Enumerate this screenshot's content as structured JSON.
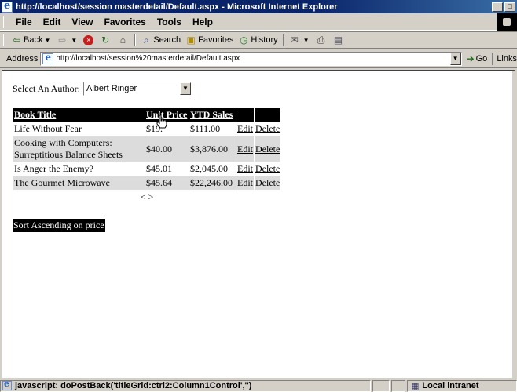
{
  "window": {
    "title": "http://localhost/session masterdetail/Default.aspx - Microsoft Internet Explorer",
    "controls": [
      "_",
      "□"
    ]
  },
  "menu": {
    "items": [
      "File",
      "Edit",
      "View",
      "Favorites",
      "Tools",
      "Help"
    ]
  },
  "toolbar": {
    "back_label": "Back",
    "search_label": "Search",
    "favorites_label": "Favorites",
    "history_label": "History"
  },
  "address": {
    "label": "Address",
    "url": "http://localhost/session%20masterdetail/Default.aspx",
    "go_label": "Go",
    "links_label": "Links"
  },
  "page": {
    "author_label": "Select An Author:",
    "author_selected": "Albert Ringer",
    "grid": {
      "headers": [
        "Book Title",
        "Unit Price",
        "YTD Sales",
        "",
        ""
      ],
      "rows": [
        {
          "title": "Life Without Fear",
          "price": "$19.",
          "sales": "$111.00",
          "edit": "Edit",
          "delete": "Delete"
        },
        {
          "title": "Cooking with Computers: Surreptitious Balance Sheets",
          "price": "$40.00",
          "sales": "$3,876.00",
          "edit": "Edit",
          "delete": "Delete"
        },
        {
          "title": "Is Anger the Enemy?",
          "price": "$45.01",
          "sales": "$2,045.00",
          "edit": "Edit",
          "delete": "Delete"
        },
        {
          "title": "The Gourmet Microwave",
          "price": "$45.64",
          "sales": "$22,246.00",
          "edit": "Edit",
          "delete": "Delete"
        }
      ],
      "pager": "< >"
    },
    "sort_banner": "Sort Ascending on price"
  },
  "status": {
    "text": "javascript:   doPostBack('titleGrid:ctrl2:Column1Control','')",
    "zone": "Local intranet"
  }
}
